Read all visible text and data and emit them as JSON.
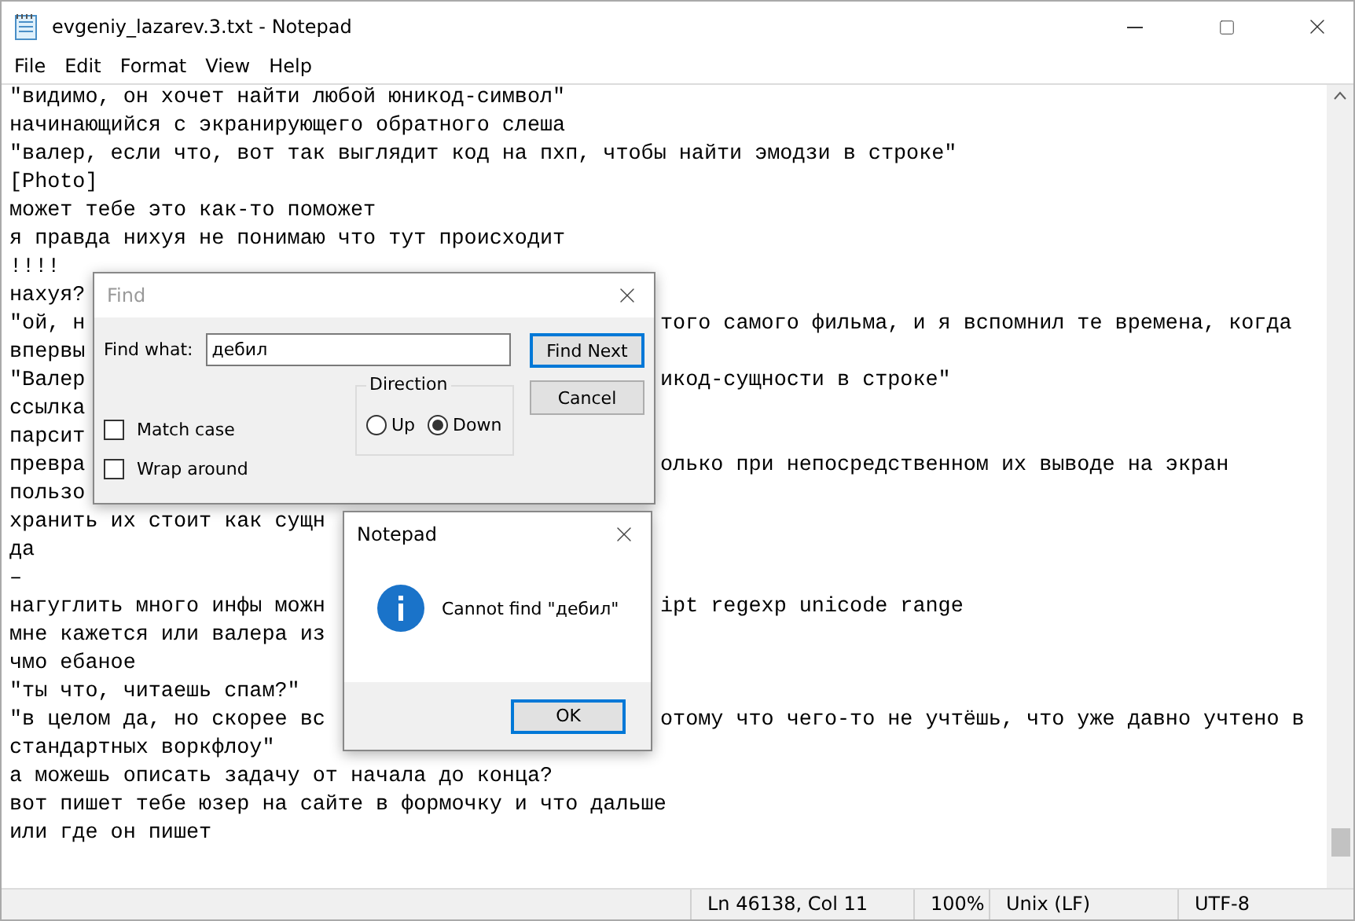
{
  "window": {
    "title": "evgeniy_lazarev.3.txt - Notepad"
  },
  "menu": [
    "File",
    "Edit",
    "Format",
    "View",
    "Help"
  ],
  "lines": [
    {
      "text": "\"видимо, он хочет найти любой юникод-символ\""
    },
    {
      "text": "начинающийся с экранирующего обратного слеша"
    },
    {
      "text": "\"валер, если что, вот так выглядит код на пхп, чтобы найти эмодзи в строке\""
    },
    {
      "text": "[Photo]"
    },
    {
      "text": "может тебе это как-то поможет"
    },
    {
      "text": "я правда нихуя не понимаю что тут происходит"
    },
    {
      "text": "!!!!"
    },
    {
      "text": "нахуя?"
    },
    {
      "text": "\"ой, н",
      "right": "того самого фильма, и я вспомнил те времена, когда"
    },
    {
      "text": "впервы"
    },
    {
      "text": "\"Валер",
      "right": "икод-сущности в строке\""
    },
    {
      "text": "ссылка"
    },
    {
      "text": "парсит"
    },
    {
      "text": "превра",
      "right": "олько при непосредственном их выводе на экран"
    },
    {
      "text": "пользо"
    },
    {
      "text": "хранить их стоит как сущн"
    },
    {
      "text": "да"
    },
    {
      "text": "–"
    },
    {
      "text": "нагуглить много инфы можн",
      "right": "ipt regexp unicode range"
    },
    {
      "text": "мне кажется или валера из"
    },
    {
      "text": "чмо ебаное"
    },
    {
      "text": "\"ты что, читаешь спам?\""
    },
    {
      "text": "\"в целом да, но скорее вс",
      "right": "отому что чего-то не учтёшь, что уже давно учтено в"
    },
    {
      "text": "стандартных воркфлоу\""
    },
    {
      "text": "а можешь описать задачу от начала до конца?"
    },
    {
      "text": "вот пишет тебе юзер на сайте в формочку и что дальше"
    },
    {
      "text": "или где он пишет"
    }
  ],
  "find_dialog": {
    "title": "Find",
    "find_what_label": "Find what:",
    "find_what_value": "дебил",
    "find_next": "Find Next",
    "cancel": "Cancel",
    "direction_label": "Direction",
    "direction": [
      {
        "label": "Up",
        "selected": false
      },
      {
        "label": "Down",
        "selected": true
      }
    ],
    "options": [
      {
        "label": "Match case",
        "checked": false
      },
      {
        "label": "Wrap around",
        "checked": false
      }
    ]
  },
  "message_dialog": {
    "title": "Notepad",
    "message": "Cannot find \"дебил\"",
    "ok": "OK"
  },
  "status_bar": [
    "Ln 46138, Col 11",
    "100%",
    "Unix (LF)",
    "UTF-8"
  ]
}
